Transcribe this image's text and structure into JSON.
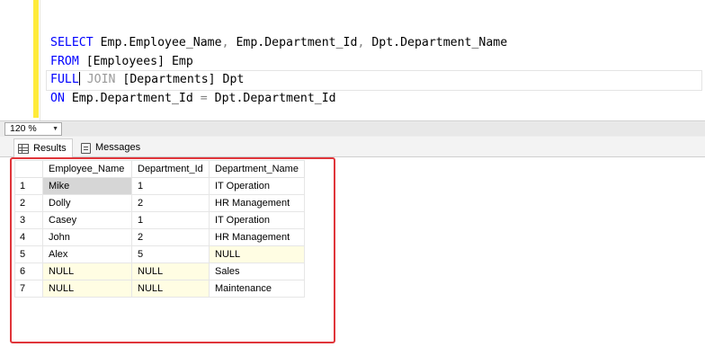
{
  "editor": {
    "lines": [
      {
        "segments": [
          {
            "text": "SELECT ",
            "cls": "kw"
          },
          {
            "text": "Emp.Employee_Name",
            "cls": ""
          },
          {
            "text": ", ",
            "cls": "op"
          },
          {
            "text": "Emp.Department_Id",
            "cls": ""
          },
          {
            "text": ", ",
            "cls": "op"
          },
          {
            "text": "Dpt.Department_Name",
            "cls": ""
          }
        ]
      },
      {
        "segments": [
          {
            "text": "FROM ",
            "cls": "kw"
          },
          {
            "text": "[Employees] Emp",
            "cls": ""
          }
        ]
      },
      {
        "segments": [
          {
            "text": "FULL",
            "cls": "kw"
          },
          {
            "text": "",
            "cls": "caret"
          },
          {
            "text": " JOIN ",
            "cls": "faded"
          },
          {
            "text": "[Departments] Dpt",
            "cls": ""
          }
        ],
        "current": true
      },
      {
        "segments": [
          {
            "text": "ON ",
            "cls": "kw"
          },
          {
            "text": "Emp.Department_Id ",
            "cls": ""
          },
          {
            "text": "= ",
            "cls": "op"
          },
          {
            "text": "Dpt.Department_Id",
            "cls": ""
          }
        ]
      }
    ]
  },
  "zoom": {
    "value": "120 %"
  },
  "tabs": {
    "results": "Results",
    "messages": "Messages"
  },
  "grid": {
    "columns": [
      "Employee_Name",
      "Department_Id",
      "Department_Name"
    ],
    "rows": [
      {
        "num": "1",
        "cells": [
          "Mike",
          "1",
          "IT Operation"
        ]
      },
      {
        "num": "2",
        "cells": [
          "Dolly",
          "2",
          "HR Management"
        ]
      },
      {
        "num": "3",
        "cells": [
          "Casey",
          "1",
          "IT Operation"
        ]
      },
      {
        "num": "4",
        "cells": [
          "John",
          "2",
          "HR Management"
        ]
      },
      {
        "num": "5",
        "cells": [
          "Alex",
          "5",
          "NULL"
        ]
      },
      {
        "num": "6",
        "cells": [
          "NULL",
          "NULL",
          "Sales"
        ]
      },
      {
        "num": "7",
        "cells": [
          "NULL",
          "NULL",
          "Maintenance"
        ]
      }
    ]
  },
  "colors": {
    "keyword": "#0000ff",
    "highlight_box": "#e0353a",
    "null_cell": "#fffde3",
    "change_bar": "#ffeb3b"
  }
}
